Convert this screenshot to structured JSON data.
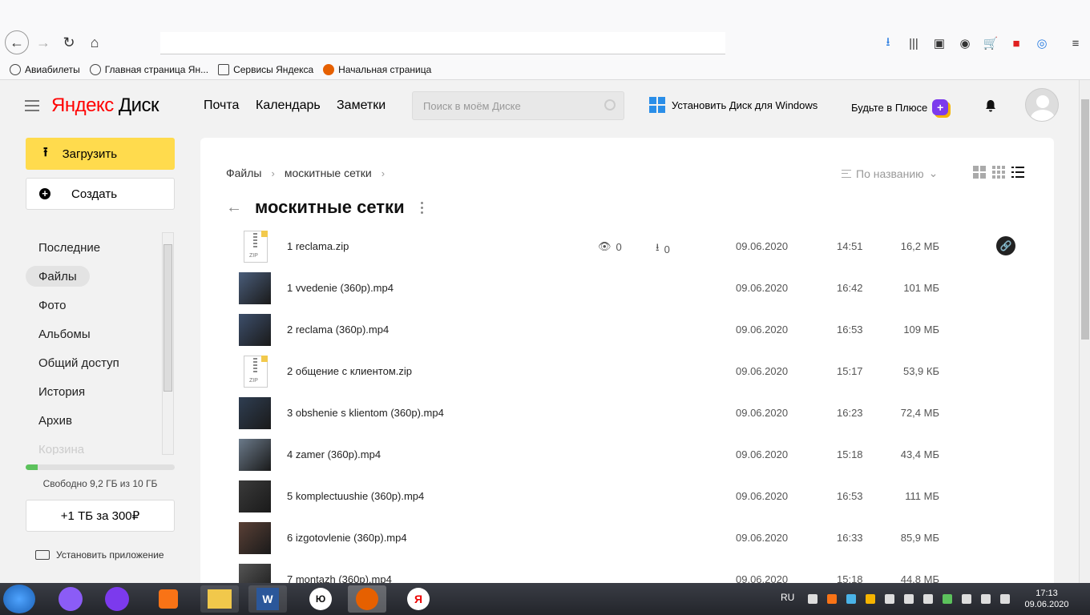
{
  "browser": {
    "bookmarks": [
      {
        "label": "Авиабилеты",
        "icon": "globe-icon"
      },
      {
        "label": "Главная страница Ян...",
        "icon": "globe-icon"
      },
      {
        "label": "Сервисы Яндекса",
        "icon": "folder-icon"
      },
      {
        "label": "Начальная страница",
        "icon": "firefox-icon"
      }
    ]
  },
  "header": {
    "logo_yandex": "Яндекс",
    "logo_disk": "Диск",
    "nav": [
      "Почта",
      "Календарь",
      "Заметки"
    ],
    "search_placeholder": "Поиск в моём Диске",
    "install_windows": "Установить Диск для Windows",
    "plus": "Будьте в Плюсе"
  },
  "sidebar": {
    "upload": "Загрузить",
    "create": "Создать",
    "nav": [
      "Последние",
      "Файлы",
      "Фото",
      "Альбомы",
      "Общий доступ",
      "История",
      "Архив",
      "Корзина"
    ],
    "active_index": 1,
    "quota_fraction": 0.08,
    "quota_text": "Свободно 9,2 ГБ из 10 ГБ",
    "upgrade": "+1 ТБ за 300₽",
    "install_app": "Установить приложение"
  },
  "main": {
    "breadcrumb": [
      "Файлы",
      "москитные сетки"
    ],
    "sort_label": "По названию",
    "folder_title": "москитные сетки",
    "files": [
      {
        "name": "1 reclama.zip",
        "type": "zip",
        "views": "0",
        "downloads": "0",
        "date": "09.06.2020",
        "time": "14:51",
        "size": "16,2 МБ",
        "shared": true
      },
      {
        "name": "1 vvedenie (360p).mp4",
        "type": "video",
        "date": "09.06.2020",
        "time": "16:42",
        "size": "101 МБ"
      },
      {
        "name": "2 reclama (360p).mp4",
        "type": "video",
        "date": "09.06.2020",
        "time": "16:53",
        "size": "109 МБ"
      },
      {
        "name": "2 общение с клиентом.zip",
        "type": "zip",
        "date": "09.06.2020",
        "time": "15:17",
        "size": "53,9 КБ"
      },
      {
        "name": "3 obshenie s klientom (360p).mp4",
        "type": "video",
        "date": "09.06.2020",
        "time": "16:23",
        "size": "72,4 МБ"
      },
      {
        "name": "4 zamer (360p).mp4",
        "type": "video",
        "date": "09.06.2020",
        "time": "15:18",
        "size": "43,4 МБ"
      },
      {
        "name": "5 komplectuushie (360p).mp4",
        "type": "video",
        "date": "09.06.2020",
        "time": "16:53",
        "size": "111 МБ"
      },
      {
        "name": "6 izgotovlenie (360p).mp4",
        "type": "video",
        "date": "09.06.2020",
        "time": "16:33",
        "size": "85,9 МБ"
      },
      {
        "name": "7 montazh (360p).mp4",
        "type": "video",
        "date": "09.06.2020",
        "time": "15:18",
        "size": "44,8 МБ"
      }
    ]
  },
  "taskbar": {
    "lang": "RU",
    "time": "17:13",
    "date": "09.06.2020"
  }
}
